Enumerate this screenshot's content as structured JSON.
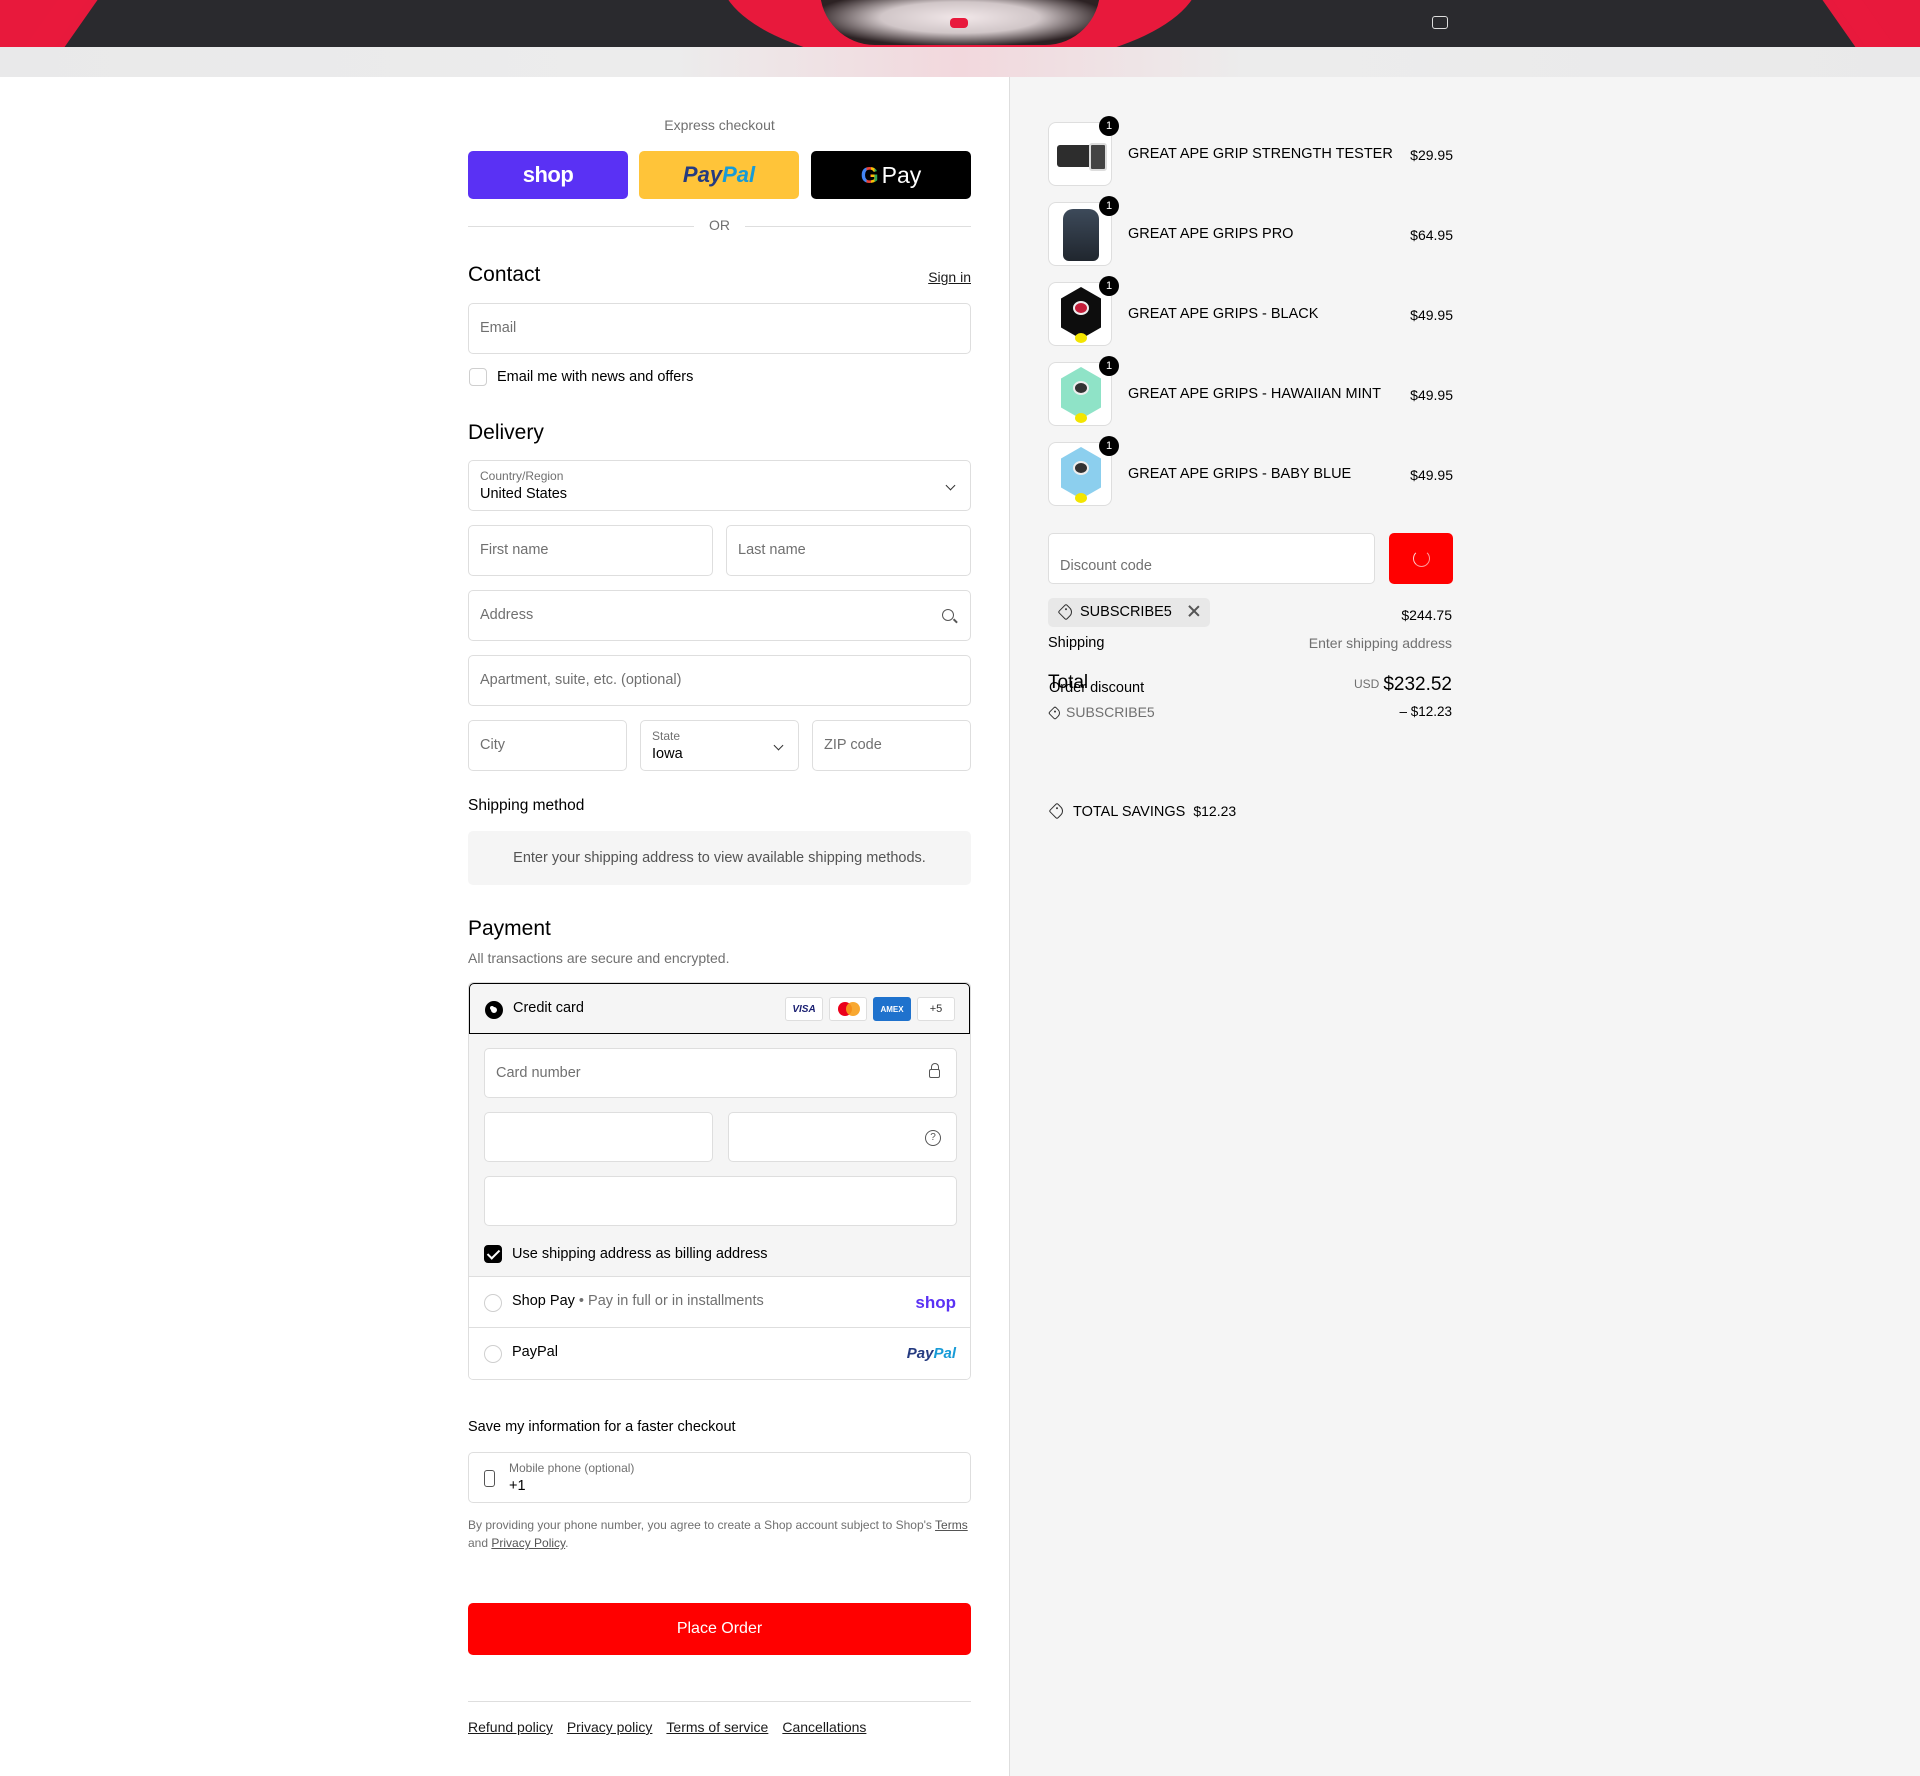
{
  "header": {
    "cart_icon": "bag-icon"
  },
  "express": {
    "title": "Express checkout",
    "shop_label": "shop",
    "paypal_label_1": "Pay",
    "paypal_label_2": "Pal",
    "gpay_g": "G",
    "gpay_label": "Pay",
    "or_label": "OR"
  },
  "contact": {
    "title": "Contact",
    "sign_in": "Sign in",
    "email_placeholder": "Email",
    "news_label": "Email me with news and offers"
  },
  "delivery": {
    "title": "Delivery",
    "country_label": "Country/Region",
    "country_value": "United States",
    "first_name": "First name",
    "last_name": "Last name",
    "address": "Address",
    "apartment": "Apartment, suite, etc. (optional)",
    "city": "City",
    "state_label": "State",
    "state_value": "Iowa",
    "zip": "ZIP code"
  },
  "shipping_method": {
    "title": "Shipping method",
    "notice": "Enter your shipping address to view available shipping methods."
  },
  "payment": {
    "title": "Payment",
    "subtitle": "All transactions are secure and encrypted.",
    "credit_card_label": "Credit card",
    "card_logos": {
      "visa": "VISA",
      "amex": "AMEX",
      "more": "+5"
    },
    "card_number": "Card number",
    "billing_label": "Use shipping address as billing address",
    "shop_pay_label": "Shop Pay",
    "shop_pay_sub": "Pay in full or in installments",
    "shop_pay_logo": "shop",
    "paypal_label": "PayPal",
    "paypal_logo_1": "Pay",
    "paypal_logo_2": "Pal"
  },
  "save_info": {
    "title": "Save my information for a faster checkout",
    "phone_label": "Mobile phone (optional)",
    "phone_value": "+1",
    "fine_1": "By providing your phone number, you agree to create a Shop account subject to Shop's ",
    "terms": "Terms",
    "fine_2": "and ",
    "privacy": "Privacy Policy",
    "fine_3": "."
  },
  "place_order": "Place Order",
  "footer": {
    "links": [
      "Refund policy",
      "Privacy policy",
      "Terms of service",
      "Cancellations"
    ]
  },
  "cart": {
    "items": [
      {
        "name": "GREAT APE GRIP STRENGTH TESTER",
        "price": "$29.95",
        "qty": "1"
      },
      {
        "name": "GREAT APE GRIPS PRO",
        "price": "$64.95",
        "qty": "1"
      },
      {
        "name": "GREAT APE GRIPS - BLACK",
        "price": "$49.95",
        "qty": "1"
      },
      {
        "name": "GREAT APE GRIPS - HAWAIIAN MINT",
        "price": "$49.95",
        "qty": "1"
      },
      {
        "name": "GREAT APE GRIPS - BABY BLUE",
        "price": "$49.95",
        "qty": "1"
      }
    ],
    "discount_placeholder": "Discount code",
    "applied_code": "SUBSCRIBE5",
    "subtotal": "$244.75",
    "shipping_label": "Shipping",
    "shipping_value": "Enter shipping address",
    "total_label": "Total",
    "order_discount_label": "Order discount",
    "currency": "USD",
    "total_value": "$232.52",
    "discount_code_line": "SUBSCRIBE5",
    "discount_value": "– $12.23",
    "savings_label": "TOTAL SAVINGS",
    "savings_value": "$12.23"
  }
}
